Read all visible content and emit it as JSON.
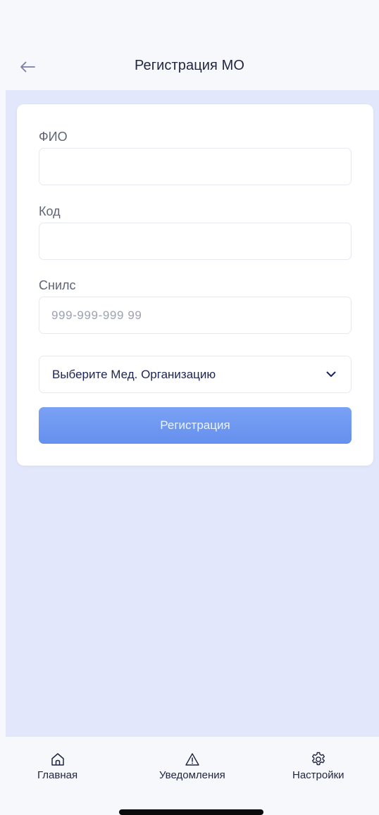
{
  "header": {
    "title": "Регистрация МО",
    "back_icon": "arrow-left-icon"
  },
  "form": {
    "fio_label": "ФИО",
    "fio_value": "",
    "code_label": "Код",
    "code_value": "",
    "snils_label": "Снилс",
    "snils_placeholder": "999-999-999 99",
    "org_select_label": "Выберите Мед. Организацию",
    "org_select_icon": "chevron-down-icon",
    "submit_label": "Регистрация"
  },
  "tabbar": {
    "items": [
      {
        "label": "Главная",
        "icon": "home-icon"
      },
      {
        "label": "Уведомления",
        "icon": "warning-icon"
      },
      {
        "label": "Настройки",
        "icon": "gear-icon"
      }
    ]
  },
  "colors": {
    "accent_button": "#6f98f2",
    "content_background": "#e2e7fb",
    "text_dark": "#1f2440"
  }
}
